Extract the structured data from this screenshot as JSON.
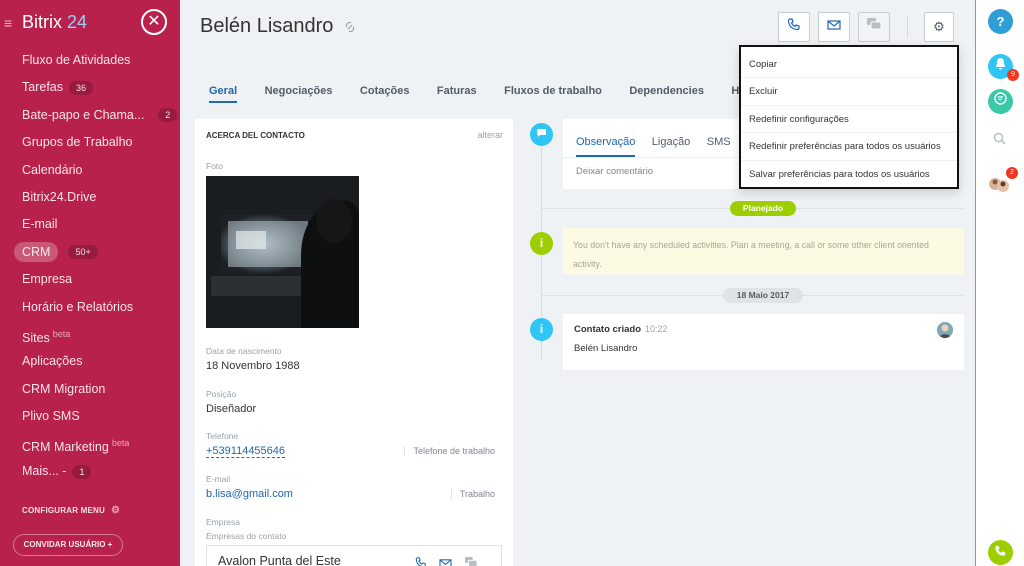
{
  "sidebar": {
    "brand_prefix": "Bitrix",
    "brand_suffix": "24",
    "close_glyph": "✕",
    "items": [
      {
        "label": "Fluxo de Atividades"
      },
      {
        "label": "Tarefas",
        "count": "36"
      },
      {
        "label": "Bate-papo e Chama...",
        "count": "2"
      },
      {
        "label": "Grupos de Trabalho"
      },
      {
        "label": "Calendário"
      },
      {
        "label": "Bitrix24.Drive"
      },
      {
        "label": "E-mail"
      },
      {
        "label": "CRM",
        "count": "50+"
      },
      {
        "label": "Empresa"
      },
      {
        "label": "Horário e Relatórios"
      },
      {
        "label": "Sites",
        "sup": "beta"
      },
      {
        "label": "Aplicações"
      },
      {
        "label": "CRM Migration"
      },
      {
        "label": "Plivo SMS"
      },
      {
        "label": "CRM Marketing",
        "sup": "beta"
      },
      {
        "label": "Mais... -",
        "count": "1"
      }
    ],
    "configure_menu": "CONFIGURAR MENU",
    "invite_users": "CONVIDAR USUÁRIO"
  },
  "header": {
    "title": "Belén Lisandro",
    "icons": [
      "phone-icon",
      "mail-icon",
      "chat-icon",
      "gear-icon"
    ]
  },
  "tabs": [
    {
      "label": "Geral",
      "active": true
    },
    {
      "label": "Negociações"
    },
    {
      "label": "Cotações"
    },
    {
      "label": "Faturas"
    },
    {
      "label": "Fluxos de trabalho"
    },
    {
      "label": "Dependencies"
    },
    {
      "label": "His"
    }
  ],
  "contact": {
    "section_title": "ACERCA DEL CONTACTO",
    "edit": "alterar",
    "photo_label": "Foto",
    "birth_label": "Data de nascimento",
    "birth_value": "18 Novembro 1988",
    "position_label": "Posição",
    "position_value": "Diseñador",
    "phone_label": "Telefone",
    "phone_value": "+539114455646",
    "phone_type": "Telefone de trabalho",
    "email_label": "E-mail",
    "email_value": "b.lisa@gmail.com",
    "email_type": "Trabalho",
    "company_label": "Empresa",
    "company_sub_label": "Empresas do contato",
    "company_name": "Avalon Punta del Este"
  },
  "editor": {
    "tabs": [
      "Observação",
      "Ligação",
      "SMS"
    ],
    "placeholder": "Deixar comentário"
  },
  "timeline": {
    "planned_badge": "Planejado",
    "notice": "You don't have any scheduled activities. Plan a meeting, a call or some other client oriented activity.",
    "date_badge": "18 Maio 2017",
    "event_title": "Contato criado",
    "event_time": "10:22",
    "event_body": "Belén Lisandro"
  },
  "dropdown": {
    "items": [
      "Copiar",
      "Excluir",
      "Redefinir configurações",
      "Redefinir preferências para todos os usuários",
      "Salvar preferências para todos os usuários"
    ]
  },
  "rail": {
    "help": "?",
    "notifications_count": "9",
    "people_count": "2"
  },
  "colors": {
    "sidebar": "#b8214c",
    "accent_blue": "#2067b0",
    "green": "#9dcf00",
    "cyan": "#2fc6f6"
  }
}
